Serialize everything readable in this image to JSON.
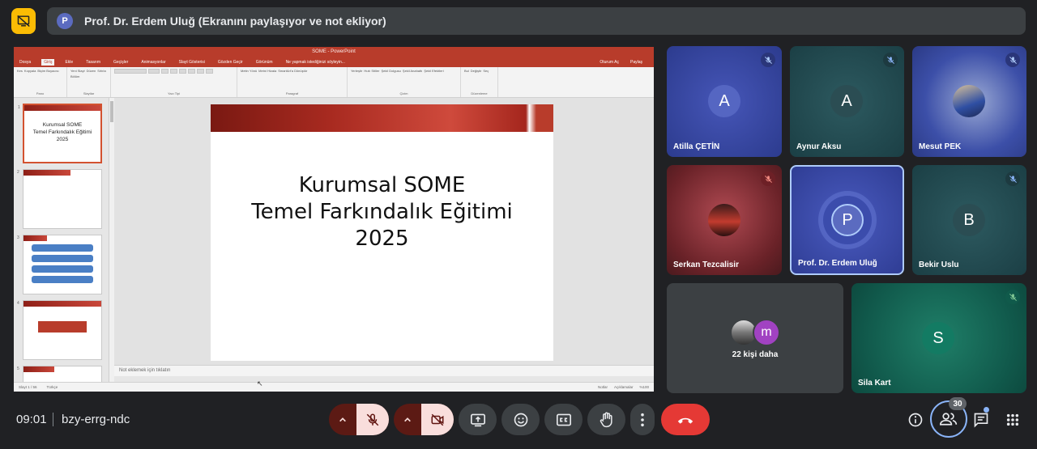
{
  "banner": {
    "avatar_letter": "P",
    "text": "Prof. Dr. Erdem Uluğ (Ekranını paylaşıyor ve not ekliyor)"
  },
  "powerpoint": {
    "title": "SOME - PowerPoint",
    "tabs": [
      "Dosya",
      "Giriş",
      "Ekle",
      "Tasarım",
      "Geçişler",
      "Animasyonlar",
      "Slayt Gösterisi",
      "Gözden Geçir",
      "Görünüm"
    ],
    "search_hint": "Ne yapmak istediğinizi söyleyin...",
    "account": "Oturum Aç",
    "share": "Paylaş",
    "ribbon_groups": [
      "Pano",
      "Slaytlar",
      "Yazı Tipi",
      "Paragraf",
      "Çizim",
      "Düzenleme"
    ],
    "ribbon_items": {
      "clipboard": [
        "Kes",
        "Kopyala",
        "Biçim Boyacısı"
      ],
      "slides": [
        "Yeni Slayt",
        "Düzen",
        "Sıfırla",
        "Bölüm"
      ],
      "paragraph": [
        "Metin Yönü",
        "Metni Hizala",
        "SmartArt'a Dönüştür"
      ],
      "drawing": [
        "Yerleştir",
        "Hızlı Stiller",
        "Şekil Dolgusu",
        "Şekil Anahattı",
        "Şekil Efektleri"
      ],
      "editing": [
        "Bul",
        "Değiştir",
        "Seç"
      ]
    },
    "thumbnails": [
      {
        "num": "1",
        "title": "Kurumsal SOME\nTemel Farkındalık Eğitimi\n2025"
      },
      {
        "num": "2",
        "title": ""
      },
      {
        "num": "3",
        "title": ""
      },
      {
        "num": "4",
        "title": ""
      },
      {
        "num": "5",
        "title": ""
      }
    ],
    "slide_title_lines": [
      "Kurumsal SOME",
      "Temel Farkındalık Eğitimi",
      "2025"
    ],
    "notes_placeholder": "Not eklemek için tıklatın",
    "status_left": "Slayt 1 / 56",
    "status_lang": "Türkçe",
    "status_notes": "Notlar",
    "status_comments": "Açıklamalar",
    "zoom": "%100"
  },
  "participants": [
    {
      "name": "Atilla ÇETİN",
      "initial": "A",
      "muted": true
    },
    {
      "name": "Aynur Aksu",
      "initial": "A",
      "muted": true
    },
    {
      "name": "Mesut PEK",
      "initial": "",
      "muted": true
    },
    {
      "name": "Serkan Tezcalisir",
      "initial": "",
      "muted": true
    },
    {
      "name": "Prof. Dr. Erdem Uluğ",
      "initial": "P",
      "muted": false
    },
    {
      "name": "Bekir Uslu",
      "initial": "B",
      "muted": true
    },
    {
      "name": "Sila Kart",
      "initial": "S",
      "muted": true
    }
  ],
  "others": {
    "label": "22 kişi daha",
    "initial": "m"
  },
  "meeting": {
    "time": "09:01",
    "code": "bzy-errg-ndc",
    "participant_count": "30"
  },
  "colors": {
    "accent_red": "#ea4335",
    "leave_red": "#e53935",
    "mic_off_bg": "#f9dedc",
    "tile_blue": "#3c4ba8",
    "tile_teal": "#1f4f54",
    "presenter_border": "#aecbfa"
  },
  "icons": {
    "present": "screen-share-icon",
    "mic": "mic-off-icon",
    "cam": "camera-off-icon",
    "share_screen": "present-screen-icon",
    "emoji": "emoji-icon",
    "captions": "captions-icon",
    "hand": "raise-hand-icon",
    "more": "more-vert-icon",
    "leave": "call-end-icon",
    "info": "info-icon",
    "people": "people-icon",
    "chat": "chat-icon",
    "apps": "apps-icon"
  }
}
